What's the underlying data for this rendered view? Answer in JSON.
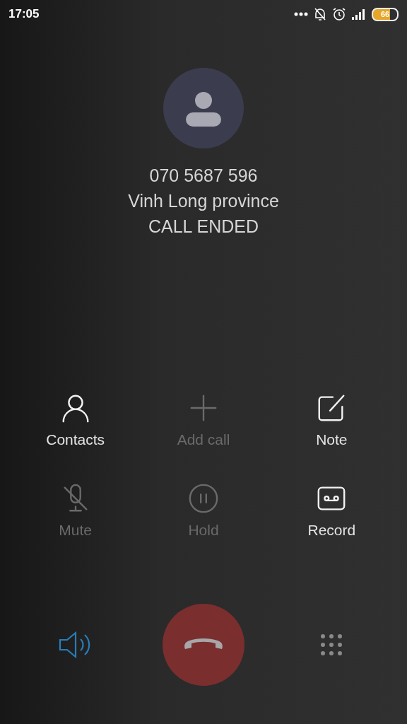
{
  "status_bar": {
    "time": "17:05",
    "battery": "66"
  },
  "caller": {
    "number": "070 5687 596",
    "location": "Vinh Long province",
    "status": "CALL ENDED"
  },
  "actions": [
    {
      "kind": "contacts",
      "label": "Contacts",
      "disabled": false
    },
    {
      "kind": "add",
      "label": "Add call",
      "disabled": true
    },
    {
      "kind": "note",
      "label": "Note",
      "disabled": false
    },
    {
      "kind": "mute",
      "label": "Mute",
      "disabled": true
    },
    {
      "kind": "hold",
      "label": "Hold",
      "disabled": true
    },
    {
      "kind": "record",
      "label": "Record",
      "disabled": false
    }
  ],
  "speaker": {
    "on": true
  }
}
